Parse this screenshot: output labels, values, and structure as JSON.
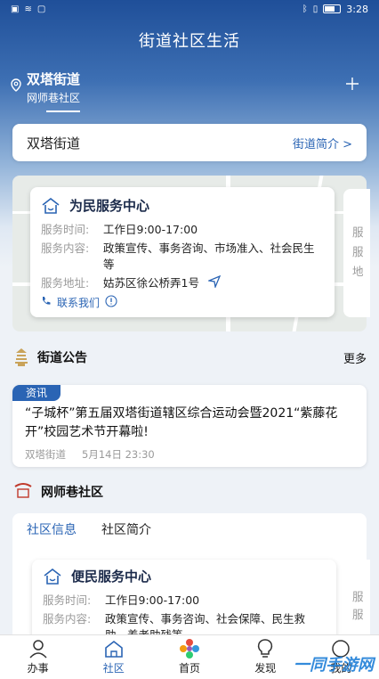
{
  "status": {
    "time": "3:28"
  },
  "app": {
    "title": "街道社区生活"
  },
  "location": {
    "street": "双塔街道",
    "community": "网师巷社区"
  },
  "street_card": {
    "name": "双塔街道",
    "link": "街道简介 >"
  },
  "service_center": {
    "title": "为民服务中心",
    "hours_label": "服务时间:",
    "hours": "工作日9:00-17:00",
    "content_label": "服务内容:",
    "content": "政策宣传、事务咨询、市场准入、社会民生等",
    "address_label": "服务地址:",
    "address": "姑苏区徐公桥弄1号",
    "contact": "联系我们"
  },
  "peek_card": {
    "line1": "服",
    "line2": "服",
    "line3": "地"
  },
  "announcements": {
    "title": "街道公告",
    "more": "更多"
  },
  "notice": {
    "tag": "资讯",
    "text": "“子城杯”第五届双塔街道辖区综合运动会暨2021“紫藤花开”校园艺术节开幕啦!",
    "source": "双塔街道",
    "date": "5月14日 23:30"
  },
  "community": {
    "title": "网师巷社区",
    "tabs": [
      "社区信息",
      "社区简介"
    ]
  },
  "community_center": {
    "title": "便民服务中心",
    "hours_label": "服务时间:",
    "hours": "工作日9:00-17:00",
    "content_label": "服务内容:",
    "content": "政策宣传、事务咨询、社会保障、民生救助、养老助残等"
  },
  "peek2": {
    "line1": "服",
    "line2": "服"
  },
  "nav": {
    "items": [
      "办事",
      "社区",
      "首页",
      "发现",
      "我的"
    ]
  },
  "watermark": "一同手游网",
  "colors": {
    "accent": "#2a64b4",
    "hero": "#1f4f99"
  }
}
